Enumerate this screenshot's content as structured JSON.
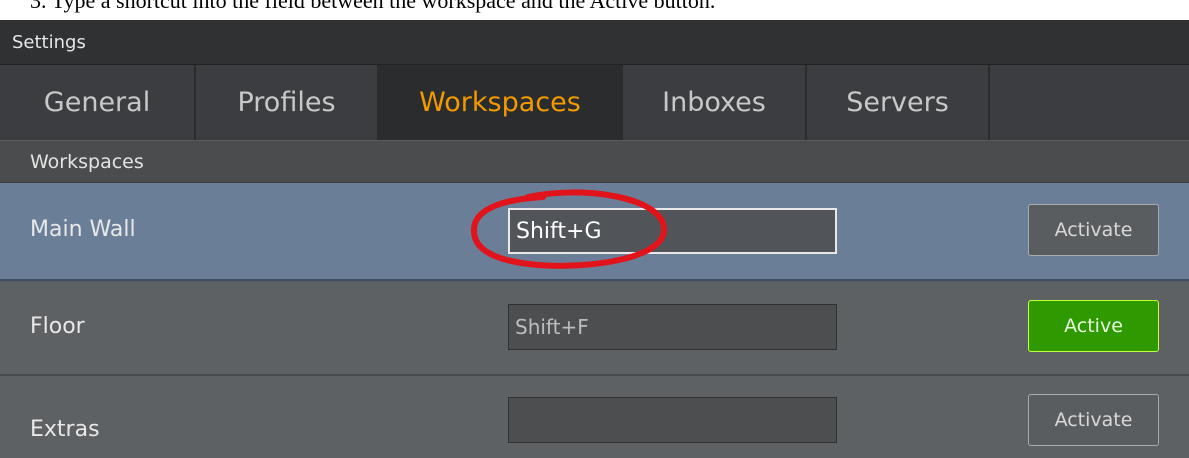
{
  "instruction": "3.  Type a shortcut into the field between the workspace and the Active button.",
  "window": {
    "title": "Settings"
  },
  "tabs": [
    {
      "label": "General",
      "active": false
    },
    {
      "label": "Profiles",
      "active": false
    },
    {
      "label": "Workspaces",
      "active": true
    },
    {
      "label": "Inboxes",
      "active": false
    },
    {
      "label": "Servers",
      "active": false
    }
  ],
  "section": {
    "title": "Workspaces"
  },
  "rows": [
    {
      "name": "Main Wall",
      "shortcut": "Shift+G",
      "button": "Activate",
      "selected": true
    },
    {
      "name": "Floor",
      "shortcut": "Shift+F",
      "button": "Active",
      "selected": false
    },
    {
      "name": "Extras",
      "shortcut": "",
      "button": "Activate",
      "selected": false
    }
  ],
  "colors": {
    "active_tab_text": "#f29a00",
    "selected_row": "#6a7f97",
    "active_button": "#2e9a00",
    "callout": "#e0141a"
  }
}
